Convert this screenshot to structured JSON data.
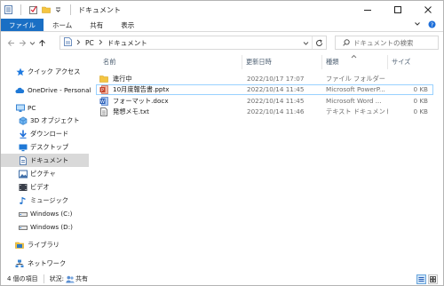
{
  "window": {
    "title": "ドキュメント"
  },
  "ribbon": {
    "tabs": [
      "ファイル",
      "ホーム",
      "共有",
      "表示"
    ]
  },
  "address": {
    "crumbs": [
      "PC",
      "ドキュメント"
    ],
    "search_placeholder": "ドキュメントの検索"
  },
  "nav": {
    "quick_access": "クイック アクセス",
    "onedrive": "OneDrive - Personal",
    "pc": "PC",
    "items": [
      "3D オブジェクト",
      "ダウンロード",
      "デスクトップ",
      "ドキュメント",
      "ピクチャ",
      "ビデオ",
      "ミュージック",
      "Windows (C:)",
      "Windows (D:)"
    ],
    "libraries": "ライブラリ",
    "network": "ネットワーク"
  },
  "columns": {
    "name": "名前",
    "modified": "更新日時",
    "type": "種類",
    "size": "サイズ"
  },
  "files": [
    {
      "name": "進行中",
      "date": "2022/10/17 17:07",
      "type": "ファイル フォルダー",
      "size": "",
      "icon": "folder-icon"
    },
    {
      "name": "10月度報告書.pptx",
      "date": "2022/10/14 11:45",
      "type": "Microsoft PowerP...",
      "size": "0 KB",
      "icon": "powerpoint-icon"
    },
    {
      "name": "フォーマット.docx",
      "date": "2022/10/14 11:45",
      "type": "Microsoft Word ...",
      "size": "0 KB",
      "icon": "word-icon"
    },
    {
      "name": "発想メモ.txt",
      "date": "2022/10/14 11:46",
      "type": "テキスト ドキュメント",
      "size": "0 KB",
      "icon": "text-file-icon"
    }
  ],
  "status": {
    "count": "4 個の項目",
    "state_label": "状況:",
    "state_value": "共有"
  },
  "colors": {
    "accent": "#1a6fc4",
    "selection_border": "#99d1ff",
    "nav_selected": "#d9d9d9"
  }
}
